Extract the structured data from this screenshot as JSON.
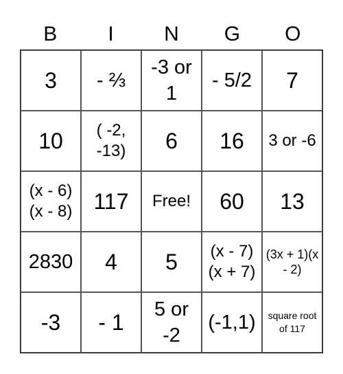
{
  "header": {
    "letters": [
      "B",
      "I",
      "N",
      "G",
      "O"
    ]
  },
  "board": {
    "rows": [
      [
        "3",
        "- ⅔",
        "-3 or 1",
        "- 5/2",
        "7"
      ],
      [
        "10",
        "( -2, -13)",
        "6",
        "16",
        "3 or -6"
      ],
      [
        "(x - 6)(x - 8)",
        "117",
        "Free!",
        "60",
        "13"
      ],
      [
        "2830",
        "4",
        "5",
        "(x - 7)(x + 7)",
        "(3x + 1)(x - 2)"
      ],
      [
        "-3",
        "- 1",
        "5 or -2",
        "(-1,1)",
        "square root of 117"
      ]
    ]
  }
}
